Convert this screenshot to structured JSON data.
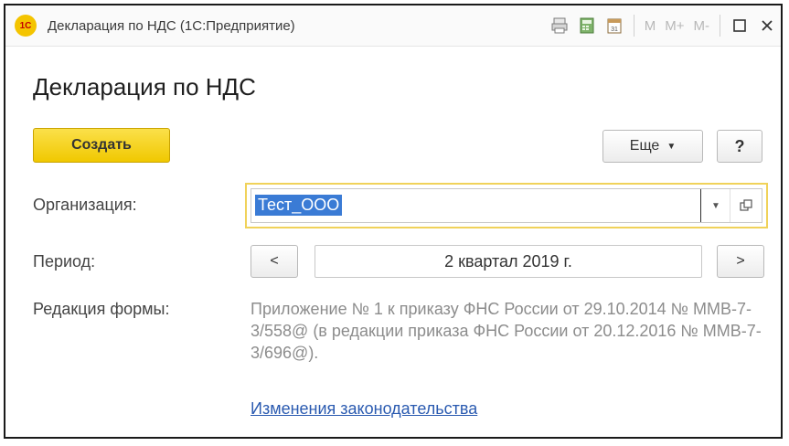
{
  "window": {
    "title": "Декларация по НДС  (1С:Предприятие)",
    "logo_text": "1С"
  },
  "toolbar": {
    "mem_labels": [
      "M",
      "M+",
      "M-"
    ]
  },
  "page": {
    "title": "Декларация по НДС"
  },
  "actions": {
    "create_label": "Создать",
    "more_label": "Еще",
    "help_label": "?"
  },
  "form": {
    "organization_label": "Организация:",
    "organization_value": "Тест_ООО",
    "period_label": "Период:",
    "period_value": "2 квартал 2019 г.",
    "prev_label": "<",
    "next_label": ">",
    "form_edition_label": "Редакция формы:",
    "form_edition_text": "Приложение № 1 к приказу ФНС России от 29.10.2014 № ММВ-7-3/558@ (в редакции приказа ФНС России от 20.12.2016 № ММВ-7-3/696@).",
    "law_changes_link": "Изменения законодательства"
  },
  "icons": {
    "app": "app-logo-icon",
    "print": "print-icon",
    "calculator": "calculator-icon",
    "calendar": "calendar-icon",
    "maximize": "maximize-icon",
    "close": "close-icon",
    "dropdown": "chevron-down-icon",
    "open": "open-external-icon"
  },
  "colors": {
    "accent": "#f0c800",
    "selection": "#3a7bd5",
    "link": "#2a5ab0",
    "focus_border": "#f0d25a"
  }
}
